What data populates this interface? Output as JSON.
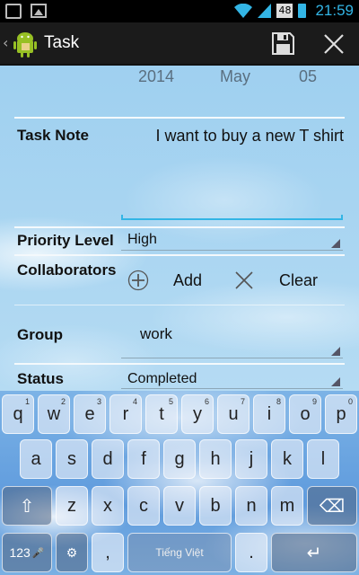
{
  "status_bar": {
    "battery_level": "48",
    "time": "21:59"
  },
  "action_bar": {
    "back_glyph": "‹",
    "title": "Task",
    "save_icon": "save-icon",
    "close_icon": "close-icon"
  },
  "date": {
    "year": "2014",
    "month": "May",
    "day": "05"
  },
  "form": {
    "task_note": {
      "label": "Task Note",
      "value": "I want to buy a new T shirt"
    },
    "priority": {
      "label": "Priority Level",
      "value": "High"
    },
    "collaborators": {
      "label": "Collaborators",
      "add_label": "Add",
      "clear_label": "Clear"
    },
    "group": {
      "label": "Group",
      "value": "work"
    },
    "status": {
      "label": "Status",
      "value": "Completed"
    }
  },
  "keyboard": {
    "row1": [
      {
        "key": "q",
        "hint": "1"
      },
      {
        "key": "w",
        "hint": "2"
      },
      {
        "key": "e",
        "hint": "3"
      },
      {
        "key": "r",
        "hint": "4"
      },
      {
        "key": "t",
        "hint": "5"
      },
      {
        "key": "y",
        "hint": "6"
      },
      {
        "key": "u",
        "hint": "7"
      },
      {
        "key": "i",
        "hint": "8"
      },
      {
        "key": "o",
        "hint": "9"
      },
      {
        "key": "p",
        "hint": "0"
      }
    ],
    "row2": [
      "a",
      "s",
      "d",
      "f",
      "g",
      "h",
      "j",
      "k",
      "l"
    ],
    "row3": [
      "z",
      "x",
      "c",
      "v",
      "b",
      "n",
      "m"
    ],
    "mode_label": "123",
    "comma": ",",
    "period": ".",
    "space_label": "Tiếng Việt",
    "shift_glyph": "⇧",
    "delete_glyph": "⌫",
    "enter_glyph": "↵",
    "mic_glyph": "🎤",
    "settings_glyph": "⚙"
  },
  "colors": {
    "accent": "#33b5e5",
    "actionbar_bg": "#1b1b1b"
  }
}
